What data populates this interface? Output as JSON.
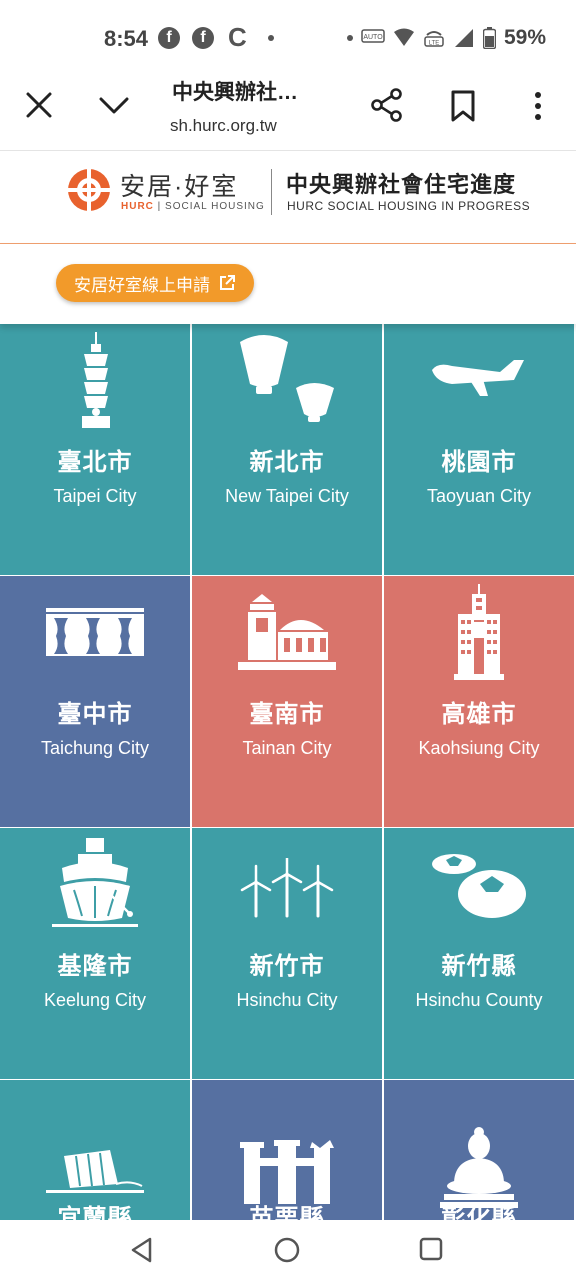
{
  "status_bar": {
    "time": "8:54",
    "battery": "59%",
    "icons": [
      "facebook-icon",
      "facebook-icon",
      "c-app-icon",
      "notification-dot",
      "auto-hd-icon",
      "wifi-icon",
      "volte-icon",
      "signal-icon",
      "battery-icon"
    ]
  },
  "toolbar": {
    "title": "中央興辦社…",
    "url": "sh.hurc.org.tw"
  },
  "header": {
    "brand_zh": "安居·好室",
    "brand_sub_hurc": "HURC",
    "brand_sub_rest": "SOCIAL HOUSING",
    "title_zh": "中央興辦社會住宅進度",
    "title_en": "HURC SOCIAL HOUSING IN PROGRESS"
  },
  "cta": {
    "label": "安居好室線上申請"
  },
  "colors": {
    "teal": "#3e9ea6",
    "blue": "#5670a1",
    "red": "#d9746b",
    "cta": "#f29a2a",
    "brand": "#e8622e"
  },
  "cities": [
    {
      "zh": "臺北市",
      "en": "Taipei City",
      "icon": "taipei-101-icon",
      "color": "teal"
    },
    {
      "zh": "新北市",
      "en": "New Taipei City",
      "icon": "sky-lantern-icon",
      "color": "teal"
    },
    {
      "zh": "桃園市",
      "en": "Taoyuan City",
      "icon": "airplane-icon",
      "color": "teal"
    },
    {
      "zh": "臺中市",
      "en": "Taichung City",
      "icon": "opera-house-icon",
      "color": "blue"
    },
    {
      "zh": "臺南市",
      "en": "Tainan City",
      "icon": "fort-icon",
      "color": "red"
    },
    {
      "zh": "高雄市",
      "en": "Kaohsiung City",
      "icon": "tower-85-icon",
      "color": "red"
    },
    {
      "zh": "基隆市",
      "en": "Keelung City",
      "icon": "ship-icon",
      "color": "teal"
    },
    {
      "zh": "新竹市",
      "en": "Hsinchu City",
      "icon": "wind-turbine-icon",
      "color": "teal"
    },
    {
      "zh": "新竹縣",
      "en": "Hsinchu County",
      "icon": "persimmon-icon",
      "color": "teal"
    },
    {
      "zh": "宜蘭縣",
      "en": "",
      "icon": "tilted-building-icon",
      "color": "teal"
    },
    {
      "zh": "苗栗縣",
      "en": "",
      "icon": "kiln-ruins-icon",
      "color": "blue"
    },
    {
      "zh": "彰化縣",
      "en": "",
      "icon": "buddha-statue-icon",
      "color": "blue"
    }
  ]
}
